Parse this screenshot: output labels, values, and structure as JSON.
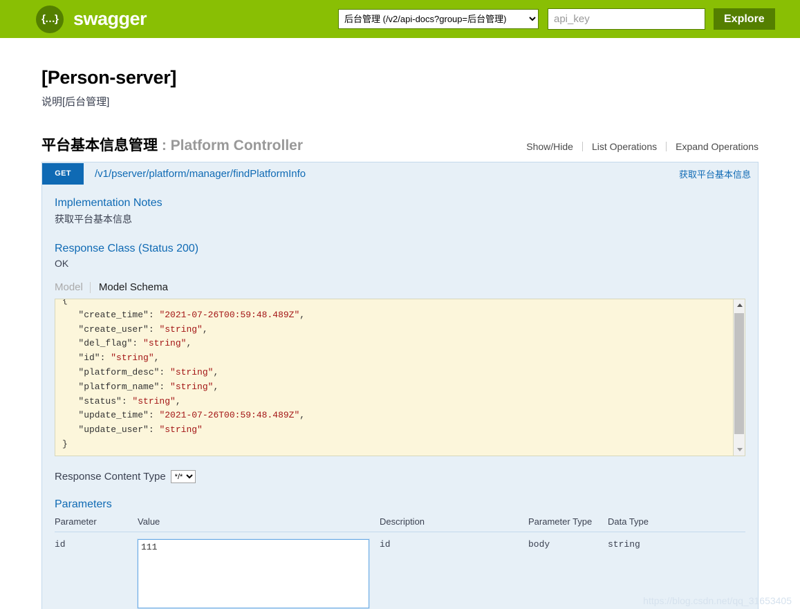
{
  "topbar": {
    "logo_glyph": "{…}",
    "logo_text": "swagger",
    "api_select_value": "后台管理 (/v2/api-docs?group=后台管理)",
    "api_key_placeholder": "api_key",
    "api_key_value": "",
    "explore_label": "Explore",
    "bar_color": "#89bf04",
    "accent_color": "#547f00"
  },
  "page": {
    "title": "[Person-server]",
    "subtitle": "说明[后台管理]"
  },
  "resource": {
    "name": "平台基本信息管理",
    "separator": " : ",
    "controller": "Platform Controller",
    "operations_links": [
      {
        "label": "Show/Hide"
      },
      {
        "label": "List Operations"
      },
      {
        "label": "Expand Operations"
      }
    ]
  },
  "operation": {
    "method": "GET",
    "method_color": "#0f6ab4",
    "path": "/v1/pserver/platform/manager/findPlatformInfo",
    "summary": "获取平台基本信息",
    "implementation_notes_title": "Implementation Notes",
    "implementation_notes_text": "获取平台基本信息",
    "response_class_title": "Response Class (Status 200)",
    "response_class_text": "OK",
    "model_tabs": [
      {
        "label": "Model",
        "active": false
      },
      {
        "label": "Model Schema",
        "active": true
      }
    ],
    "schema_json": "{\n   \"create_time\": \"2021-07-26T00:59:48.489Z\",\n   \"create_user\": \"string\",\n   \"del_flag\": \"string\",\n   \"id\": \"string\",\n   \"platform_desc\": \"string\",\n   \"platform_name\": \"string\",\n   \"status\": \"string\",\n   \"update_time\": \"2021-07-26T00:59:48.489Z\",\n   \"update_user\": \"string\"\n}",
    "schema_lines": [
      {
        "key": "",
        "value": "",
        "raw": "{"
      },
      {
        "key": "\"create_time\"",
        "value": "\"2021-07-26T00:59:48.489Z\"",
        "comma": true
      },
      {
        "key": "\"create_user\"",
        "value": "\"string\"",
        "comma": true
      },
      {
        "key": "\"del_flag\"",
        "value": "\"string\"",
        "comma": true
      },
      {
        "key": "\"id\"",
        "value": "\"string\"",
        "comma": true
      },
      {
        "key": "\"platform_desc\"",
        "value": "\"string\"",
        "comma": true
      },
      {
        "key": "\"platform_name\"",
        "value": "\"string\"",
        "comma": true
      },
      {
        "key": "\"status\"",
        "value": "\"string\"",
        "comma": true
      },
      {
        "key": "\"update_time\"",
        "value": "\"2021-07-26T00:59:48.489Z\"",
        "comma": true
      },
      {
        "key": "\"update_user\"",
        "value": "\"string\"",
        "comma": false
      },
      {
        "key": "",
        "value": "",
        "raw": "}"
      }
    ],
    "response_content_type_label": "Response Content Type",
    "response_content_type_value": "*/*",
    "parameters_title": "Parameters",
    "parameters_headers": [
      "Parameter",
      "Value",
      "Description",
      "Parameter Type",
      "Data Type"
    ],
    "parameters_rows": [
      {
        "parameter": "id",
        "value": "111",
        "description": "id",
        "parameter_type": "body",
        "data_type": "string"
      }
    ]
  },
  "watermark": "https://blog.csdn.net/qq_31653405"
}
